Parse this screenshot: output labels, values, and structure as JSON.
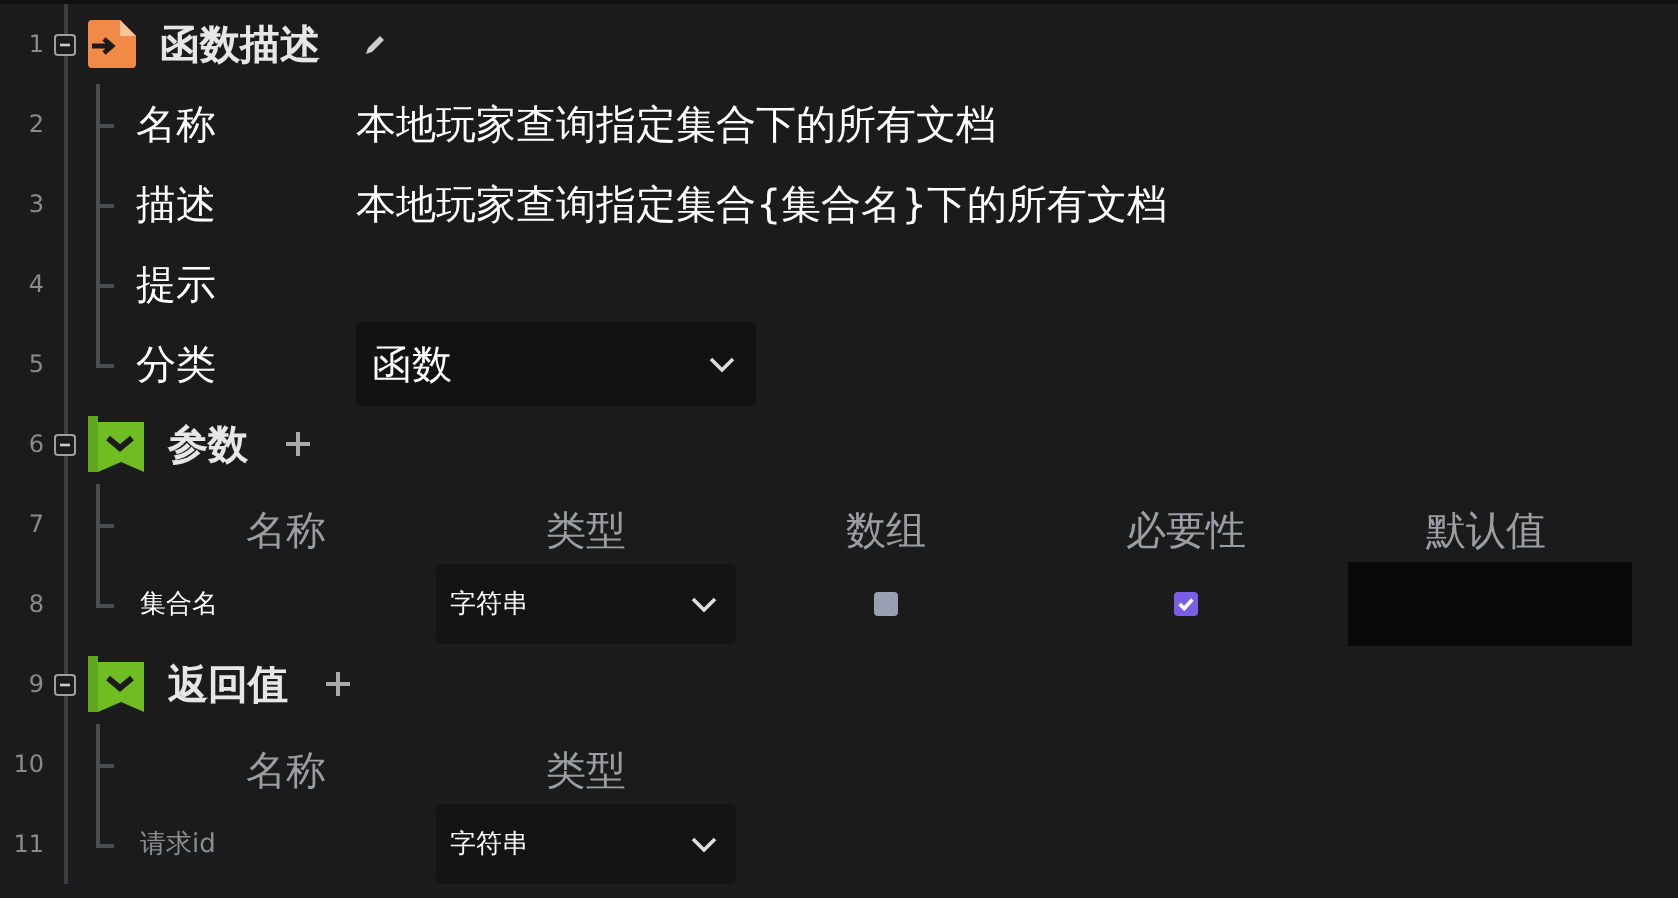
{
  "sections": [
    {
      "kind": "function",
      "line": "1",
      "title": "函数描述",
      "expanded": true,
      "properties": [
        {
          "line": "2",
          "label": "名称",
          "kind": "text",
          "value": "本地玩家查询指定集合下的所有文档"
        },
        {
          "line": "3",
          "label": "描述",
          "kind": "text",
          "value": "本地玩家查询指定集合{集合名}下的所有文档"
        },
        {
          "line": "4",
          "label": "提示",
          "kind": "text"
        },
        {
          "line": "5",
          "label": "分类",
          "kind": "select",
          "value": "函数"
        }
      ]
    },
    {
      "kind": "list",
      "line": "6",
      "title": "参数",
      "expanded": true,
      "header_line": "7",
      "columns": [
        "名称",
        "类型",
        "数组",
        "必要性",
        "默认值"
      ],
      "rows": [
        {
          "line": "8",
          "name": {
            "value": "集合名"
          },
          "type": "字符串",
          "array": false,
          "required": true
        }
      ]
    },
    {
      "kind": "list",
      "line": "9",
      "title": "返回值",
      "expanded": true,
      "header_line": "10",
      "columns": [
        "名称",
        "类型"
      ],
      "rows": [
        {
          "line": "11",
          "name": {
            "placeholder": "请求id"
          },
          "type": "字符串"
        }
      ]
    }
  ]
}
